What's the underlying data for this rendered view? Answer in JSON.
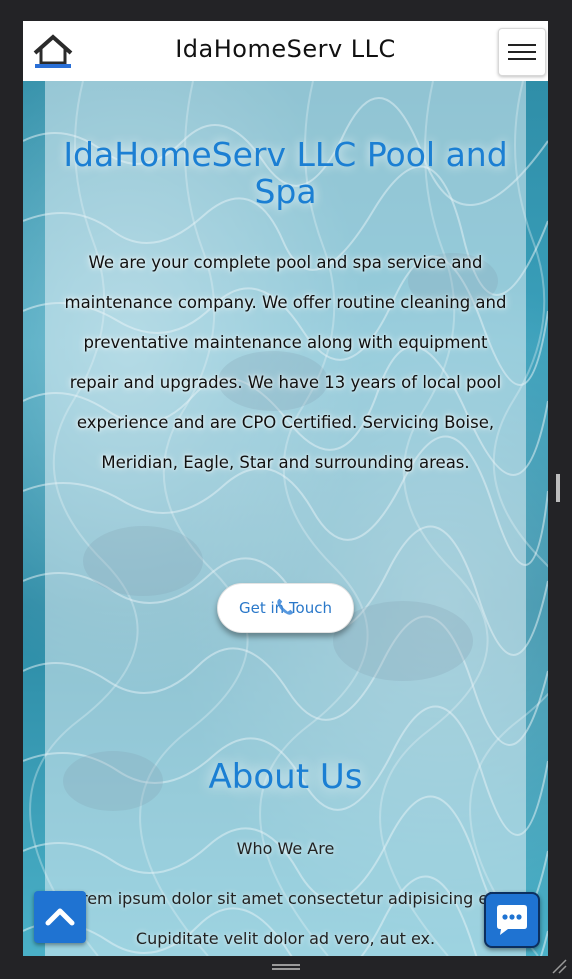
{
  "header": {
    "site_title": "IdaHomeServ LLC",
    "logo_icon": "house-roof-logo-icon",
    "menu_icon": "hamburger-menu-icon"
  },
  "hero": {
    "title": "IdaHomeServ LLC Pool and Spa",
    "description": "We are your complete pool and spa service and maintenance company. We offer routine cleaning and preventative maintenance along with equipment repair and upgrades. We have 13 years of local pool experience and are CPO Certified. Servicing Boise, Meridian, Eagle, Star and surrounding areas.",
    "cta_label": "Get in Touch",
    "cta_icon": "phone-icon"
  },
  "about": {
    "title": "About Us",
    "subtitle": "Who We Are",
    "body": "Lorem ipsum dolor sit amet consectetur adipisicing elit. Cupiditate velit dolor ad vero, aut ex."
  },
  "floating": {
    "scroll_top_icon": "chevron-up-icon",
    "chat_icon": "chat-bubble-icon"
  },
  "colors": {
    "accent": "#1b7fd3",
    "button_blue": "#1f73d2",
    "chrome_background": "#232326",
    "header_background": "#ffffff"
  }
}
